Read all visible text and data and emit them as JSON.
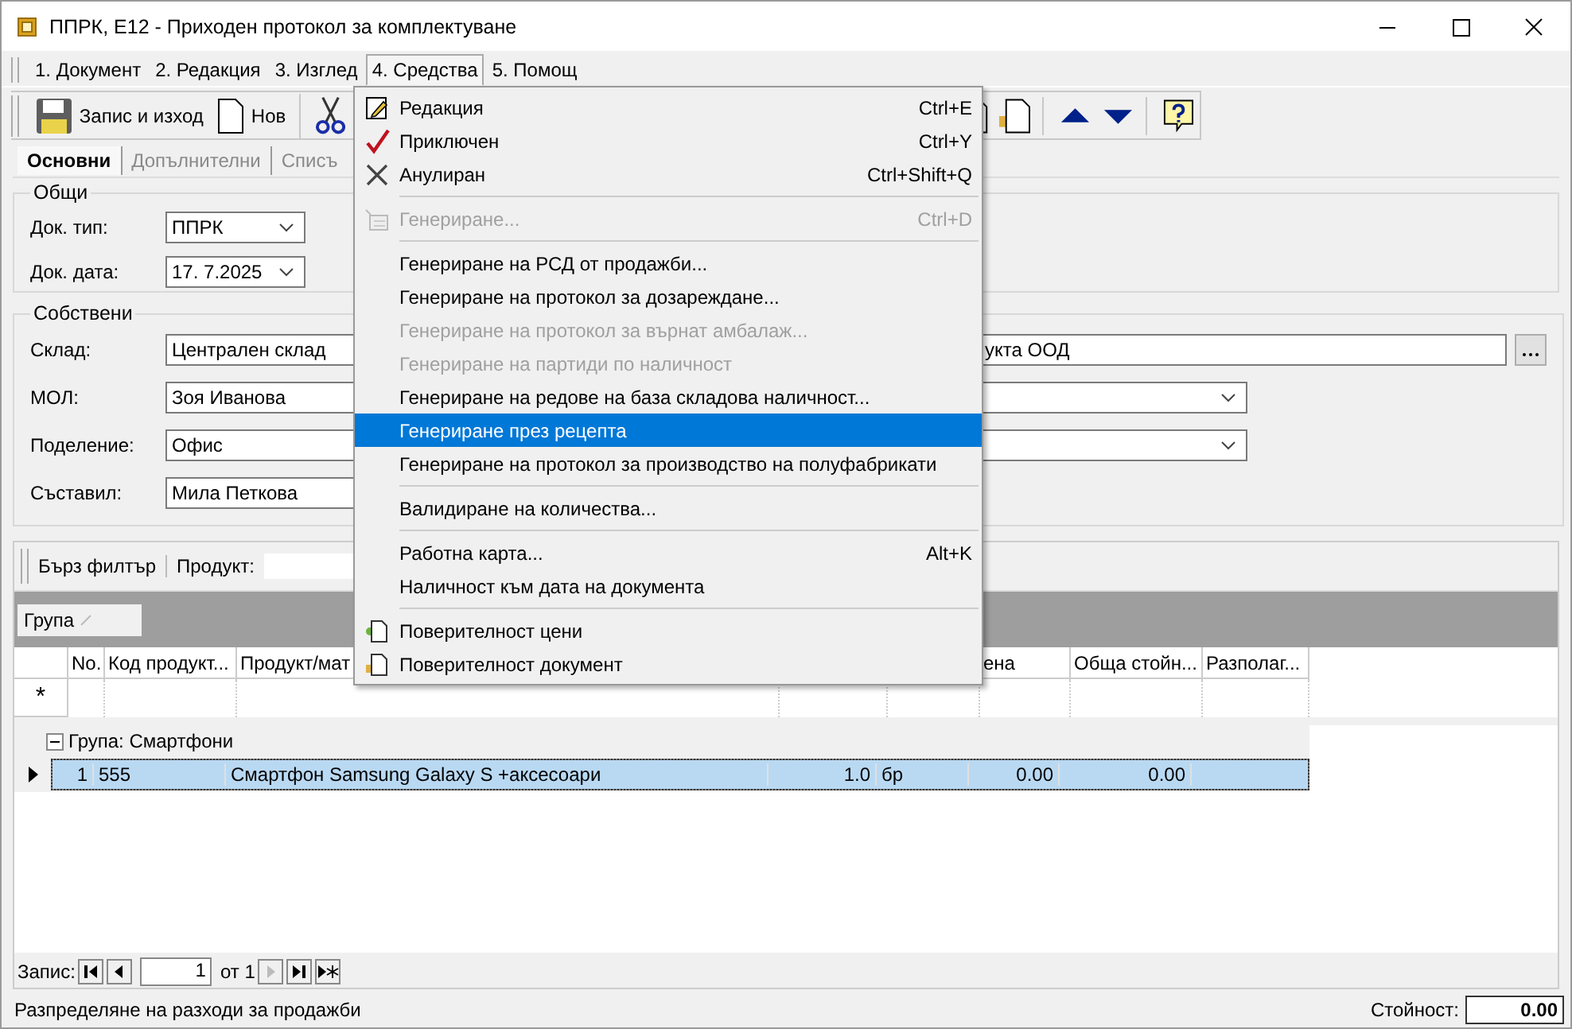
{
  "window": {
    "title": "ППРК, Е12 - Приходен протокол за комплектуване"
  },
  "menu_bar": [
    {
      "label": "1. Документ",
      "selected": false
    },
    {
      "label": "2. Редакция",
      "selected": false
    },
    {
      "label": "3. Изглед",
      "selected": false
    },
    {
      "label": "4. Средства",
      "selected": true
    },
    {
      "label": "5. Помощ",
      "selected": false
    }
  ],
  "toolbar": [
    {
      "kind": "save",
      "label": "Запис и изход"
    },
    {
      "kind": "new",
      "label": "Нов"
    },
    {
      "kind": "cut"
    },
    {
      "kind": "gap"
    },
    {
      "kind": "doc"
    },
    {
      "kind": "doc-lock"
    },
    {
      "kind": "up"
    },
    {
      "kind": "down"
    },
    {
      "kind": "help"
    }
  ],
  "tabs": [
    {
      "label": "Основни",
      "selected": true
    },
    {
      "label": "Допълнителни",
      "selected": false
    },
    {
      "label": "Списъ",
      "selected": false
    }
  ],
  "general": {
    "title": "Общи",
    "fields": [
      {
        "label": "Док. тип:",
        "value": "ППРК"
      },
      {
        "label": "Док. дата:",
        "value": "17.  7.2025"
      }
    ]
  },
  "own": {
    "title": "Собствени",
    "fields": [
      {
        "kind": "lookup",
        "label": "Склад:",
        "value": "Централен склад",
        "second_value": "укта ООД"
      },
      {
        "kind": "select",
        "label": "МОЛ:",
        "value": "Зоя Иванова"
      },
      {
        "kind": "select",
        "label": "Поделение:",
        "value": "Офис"
      },
      {
        "kind": "text",
        "label": "Съставил:",
        "value": "Мила Петкова"
      }
    ]
  },
  "grid": {
    "filter_label": "Бърз филтър",
    "product_label": "Продукт:",
    "group_chip": "Група",
    "columns": [
      {
        "label": "No."
      },
      {
        "label": "Код продукт..."
      },
      {
        "label": "Продукт/мат"
      },
      {},
      {},
      {
        "label": "ена"
      },
      {
        "label": "Обща стойн..."
      },
      {
        "label": "Разполаг..."
      }
    ],
    "new_row_marker": "*",
    "group_row": {
      "label": "Група: Смартфони",
      "expanded": true
    },
    "rows": [
      {
        "selected": true,
        "cells": [
          "1",
          "555",
          "Смартфон Samsung Galaxy S +аксесоари",
          "1.0",
          "бр",
          "0.00",
          "0.00",
          null
        ]
      }
    ]
  },
  "navigator": {
    "label": "Запис:",
    "page": "1",
    "of": "от 1"
  },
  "status": {
    "text": "Разпределяне на разходи за продажби",
    "total_label": "Стойност:",
    "total": "0.00"
  },
  "menu": [
    {
      "kind": "item",
      "label": "Редакция",
      "shortcut": "Ctrl+E",
      "disabled": false,
      "selected": false
    },
    {
      "kind": "item",
      "label": "Приключен",
      "shortcut": "Ctrl+Y",
      "disabled": false,
      "selected": false
    },
    {
      "kind": "item",
      "label": "Анулиран",
      "shortcut": "Ctrl+Shift+Q",
      "disabled": false,
      "selected": false
    },
    {
      "kind": "separator"
    },
    {
      "kind": "item",
      "label": "Генериране...",
      "shortcut": "Ctrl+D",
      "disabled": true,
      "selected": false
    },
    {
      "kind": "separator"
    },
    {
      "kind": "item",
      "label": "Генериране на РСД от продажби...",
      "disabled": false,
      "selected": false
    },
    {
      "kind": "item",
      "label": "Генериране на протокол за дозареждане...",
      "disabled": false,
      "selected": false
    },
    {
      "kind": "item",
      "label": "Генериране на протокол за върнат амбалаж...",
      "disabled": true,
      "selected": false
    },
    {
      "kind": "item",
      "label": "Генериране на партиди по наличност",
      "disabled": true,
      "selected": false
    },
    {
      "kind": "item",
      "label": "Генериране на редове на база складова наличност...",
      "disabled": false,
      "selected": false
    },
    {
      "kind": "item",
      "label": "Генериране през рецепта",
      "disabled": false,
      "selected": true
    },
    {
      "kind": "item",
      "label": "Генериране на протокол за производство на полуфабрикати",
      "disabled": false,
      "selected": false
    },
    {
      "kind": "separator"
    },
    {
      "kind": "item",
      "label": "Валидиране на количества...",
      "disabled": false,
      "selected": false
    },
    {
      "kind": "separator"
    },
    {
      "kind": "item",
      "label": "Работна карта...",
      "shortcut": "Alt+K",
      "disabled": false,
      "selected": false
    },
    {
      "kind": "item",
      "label": "Наличност към дата на документа",
      "disabled": false,
      "selected": false
    },
    {
      "kind": "separator"
    },
    {
      "kind": "item",
      "label": "Поверителност цени",
      "disabled": false,
      "selected": false
    },
    {
      "kind": "item",
      "label": "Поверителност документ",
      "disabled": false,
      "selected": false
    }
  ]
}
